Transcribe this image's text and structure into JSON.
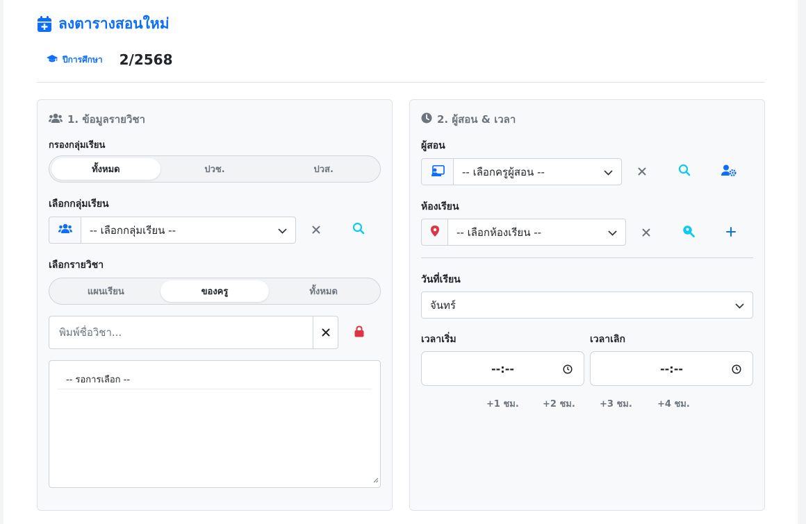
{
  "header": {
    "title": "ลงตารางสอนใหม่",
    "year_label": "ปีการศึกษา",
    "year_value": "2/2568"
  },
  "course_panel": {
    "title": "1. ข้อมูลรายวิชา",
    "filter_label": "กรองกลุ่มเรียน",
    "filter_tabs": [
      {
        "label": "ทั้งหมด",
        "active": true
      },
      {
        "label": "ปวช.",
        "active": false
      },
      {
        "label": "ปวส.",
        "active": false
      }
    ],
    "group_label": "เลือกกลุ่มเรียน",
    "group_select": "-- เลือกกลุ่มเรียน --",
    "subject_label": "เลือกรายวิชา",
    "subject_tabs": [
      {
        "label": "แผนเรียน",
        "active": false
      },
      {
        "label": "ของครู",
        "active": true
      },
      {
        "label": "ทั้งหมด",
        "active": false
      }
    ],
    "subject_search_placeholder": "พิมพ์ชื่อวิชา...",
    "subject_list": [
      "-- รอการเลือก --"
    ]
  },
  "schedule_panel": {
    "title": "2. ผู้สอน & เวลา",
    "teacher_label": "ผู้สอน",
    "teacher_select": "-- เลือกครูผู้สอน --",
    "room_label": "ห้องเรียน",
    "room_select": "-- เลือกห้องเรียน --",
    "day_label": "วันที่เรียน",
    "day_select": "จันทร์",
    "start_label": "เวลาเริ่ม",
    "end_label": "เวลาเลิก",
    "start_time": "--:--",
    "end_time": "--:--",
    "quick_buttons": [
      "+1 ชม.",
      "+2 ชม.",
      "+3 ชม.",
      "+4 ชม."
    ]
  },
  "colors": {
    "primary": "#0d6efd",
    "info": "#0dcaf0",
    "danger": "#dc3545",
    "muted": "#6c757d"
  }
}
